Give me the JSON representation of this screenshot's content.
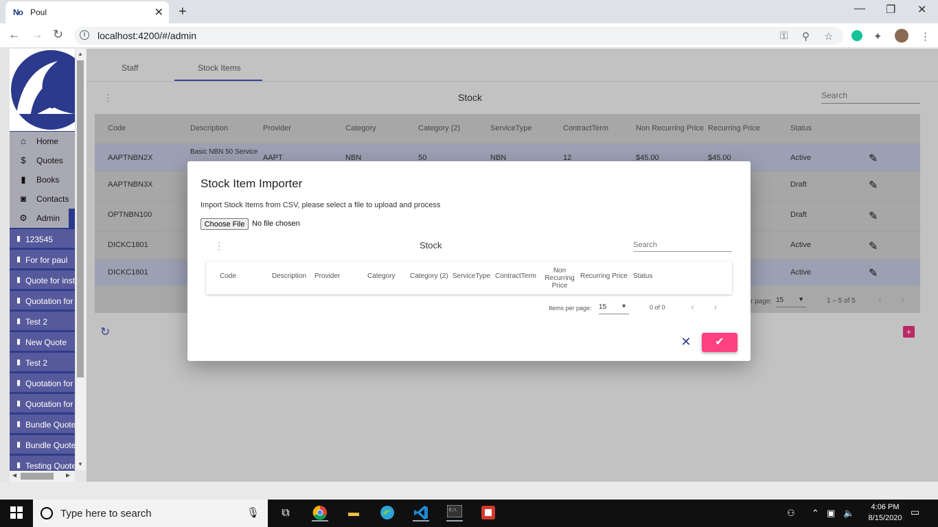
{
  "browser": {
    "tab_favicon": "No",
    "tab_title": "Poul",
    "url": "localhost:4200/#/admin"
  },
  "sidebar": {
    "nav": [
      {
        "icon": "home-icon",
        "label": "Home"
      },
      {
        "icon": "quotes-icon",
        "label": "Quotes"
      },
      {
        "icon": "book-icon",
        "label": "Books"
      },
      {
        "icon": "contacts-icon",
        "label": "Contacts"
      },
      {
        "icon": "gear-icon",
        "label": "Admin"
      }
    ],
    "quotes": [
      "123545",
      "For for paul",
      "Quote for inst",
      "Quotation for",
      "Test 2",
      "New Quote",
      "Test 2",
      "Quotation for",
      "Quotation for",
      "Bundle Quote",
      "Bundle Quote",
      "Testing Quote"
    ]
  },
  "admin": {
    "tabs": [
      "Staff",
      "Stock Items"
    ],
    "active_tab": "Stock Items",
    "table_title": "Stock",
    "search_placeholder": "Search",
    "columns": [
      "Code",
      "Description",
      "Provider",
      "Category",
      "Category (2)",
      "ServiceType",
      "ContractTerm",
      "Non Recurring Price",
      "Recurring Price",
      "Status"
    ],
    "rows": [
      {
        "code": "AAPTNBN2X",
        "description": "Basic NBN 50 Service",
        "provider": "AAPT",
        "category": "NBN",
        "category2": "50",
        "service_type": "NBN",
        "contract_term": "12",
        "non_recurring": "$45.00",
        "recurring": "$45.00",
        "status": "Active"
      },
      {
        "code": "AAPTNBN3X",
        "status": "Draft"
      },
      {
        "code": "OPTNBN100",
        "status": "Draft"
      },
      {
        "code": "DICKC1801",
        "status": "Active"
      },
      {
        "code": "DICKC1801",
        "status": "Active"
      }
    ],
    "paginator": {
      "label": "r page:",
      "size": "15",
      "range": "1 – 5 of 5"
    }
  },
  "dialog": {
    "title": "Stock Item Importer",
    "description": "Import Stock Items from CSV, please select a file to upload and process",
    "choose_file": "Choose File",
    "no_file": "No file chosen",
    "table_title": "Stock",
    "search_placeholder": "Search",
    "columns": [
      "Code",
      "Description",
      "Provider",
      "Category",
      "Category (2)",
      "ServiceType",
      "ContractTerm",
      "Non Recurring Price",
      "Recurring Price",
      "Status"
    ],
    "paginator": {
      "label": "Items per page:",
      "size": "15",
      "range": "0 of 0"
    }
  },
  "taskbar": {
    "search_placeholder": "Type here to search",
    "time": "4:06 PM",
    "date": "8/15/2020"
  },
  "colors": {
    "sidebar_bg": "#2b3a8c",
    "accent": "#3f51b5",
    "confirm": "#ff4081"
  }
}
